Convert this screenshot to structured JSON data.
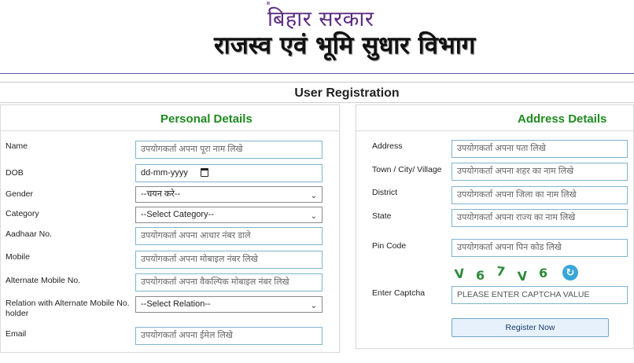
{
  "header": {
    "line1": "बिहार सरकार",
    "line2": "राजस्व एवं भूमि सुधार विभाग"
  },
  "page_title": "User Registration",
  "personal": {
    "heading": "Personal Details",
    "name": {
      "label": "Name",
      "placeholder": "उपयोगकर्ता अपना पूरा नाम लिखे"
    },
    "dob": {
      "label": "DOB",
      "placeholder": "dd-mm-yyyy"
    },
    "gender": {
      "label": "Gender",
      "selected": "--चयन करे--"
    },
    "category": {
      "label": "Category",
      "selected": "--Select Category--"
    },
    "aadhaar": {
      "label": "Aadhaar No.",
      "placeholder": "उपयोगकर्ता अपना आधार नंबर डाले"
    },
    "mobile": {
      "label": "Mobile",
      "placeholder": "उपयोगकर्ता अपना मोबाइल नंबर लिखे"
    },
    "alt_mobile": {
      "label": "Alternate Mobile No.",
      "placeholder": "उपयोगकर्ता अपना वैकल्पिक मोबाइल नंबर लिखे"
    },
    "relation": {
      "label_line1": "Relation with Alternate Mobile No.",
      "label_line2": "holder",
      "selected": "--Select Relation--"
    },
    "email": {
      "label": "Email",
      "placeholder": "उपयोगकर्ता अपना ईमेल लिखे"
    }
  },
  "address": {
    "heading": "Address Details",
    "address": {
      "label": "Address",
      "placeholder": "उपयोगकर्ता अपना पता लिखे"
    },
    "town": {
      "label": "Town / City/ Village",
      "placeholder": "उपयोगकर्ता अपना शहर का नाम लिखे"
    },
    "district": {
      "label": "District",
      "placeholder": "उपयोगकर्ता अपना जिला का नाम लिखे"
    },
    "state": {
      "label": "State",
      "placeholder": "उपयोगकर्ता अपना राज्य का नाम लिखे"
    },
    "pincode": {
      "label": "Pin Code",
      "placeholder": "उपयोगकर्ता अपना पिन कोड लिखे"
    },
    "captcha_chars": [
      "V",
      "6",
      "7",
      "V",
      "6"
    ],
    "captcha": {
      "label": "Enter Captcha",
      "placeholder": "PLEASE ENTER CAPTCHA VALUE"
    },
    "register_label": "Register Now"
  },
  "colors": {
    "heading_green": "#1f8a1f",
    "field_border": "#7fb3d0",
    "captcha_green": "#2d8a3a",
    "title_purple": "#5d2e82"
  }
}
